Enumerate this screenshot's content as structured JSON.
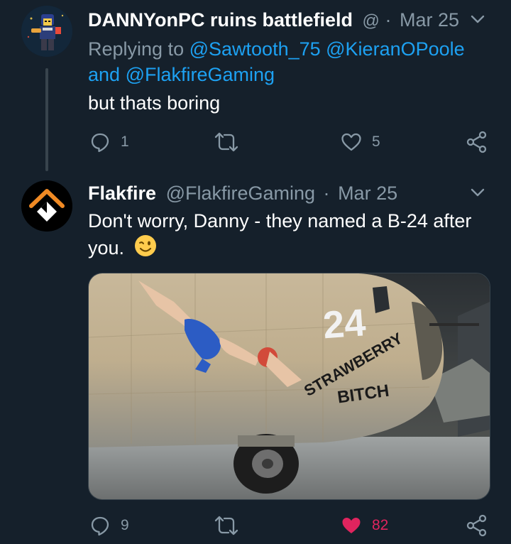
{
  "tweets": [
    {
      "display_name": "DANNYonPC ruins battlefield",
      "handle_trunc": "@",
      "separator": "·",
      "date": "Mar 25",
      "reply_prefix": "Replying to",
      "mentions_line1": "@Sawtooth_75 @KieranOPoole",
      "mentions_and": "and",
      "mentions_line2": "@FlakfireGaming",
      "text": "but thats boring",
      "reply_count": "1",
      "retweet_count": "",
      "like_count": "5"
    },
    {
      "display_name": "Flakfire",
      "handle": "@FlakfireGaming",
      "separator": "·",
      "date": "Mar 25",
      "text_line1": "Don't worry, Danny - they named a B-24 after",
      "text_line2": "you.",
      "emoji": "winking-face",
      "image_nose_number": "24",
      "image_art_line1": "STRAWBERRY",
      "image_art_line2": "BITCH",
      "reply_count": "9",
      "retweet_count": "",
      "like_count": "82",
      "liked": true
    }
  ],
  "colors": {
    "background": "#15202b",
    "text": "#ffffff",
    "muted": "#8899a6",
    "link": "#1da1f2",
    "like": "#e0245e",
    "emoji": "#ffcc4d"
  }
}
